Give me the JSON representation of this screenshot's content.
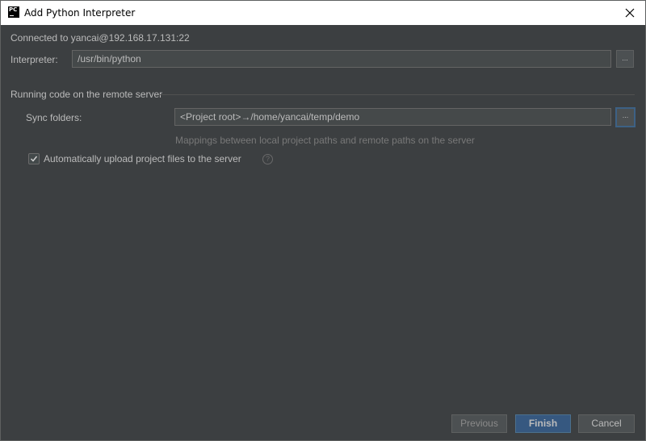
{
  "window": {
    "title": "Add Python Interpreter",
    "app_icon_text": "PC"
  },
  "connection": {
    "text": "Connected to yancai@192.168.17.131:22"
  },
  "interpreter": {
    "label": "Interpreter:",
    "value": "/usr/bin/python",
    "browse_label": "..."
  },
  "remote_section": {
    "title": "Running code on the remote server",
    "sync_label": "Sync folders:",
    "sync_value": "<Project root>→/home/yancai/temp/demo",
    "sync_browse_label": "...",
    "hint": "Mappings between local project paths and remote paths on the server",
    "auto_upload_label": "Automatically upload project files to the server",
    "auto_upload_checked": true,
    "help_glyph": "?"
  },
  "buttons": {
    "previous": "Previous",
    "finish": "Finish",
    "cancel": "Cancel"
  },
  "colors": {
    "background": "#3c3f41",
    "accent": "#365880",
    "text": "#bbbbbb"
  }
}
